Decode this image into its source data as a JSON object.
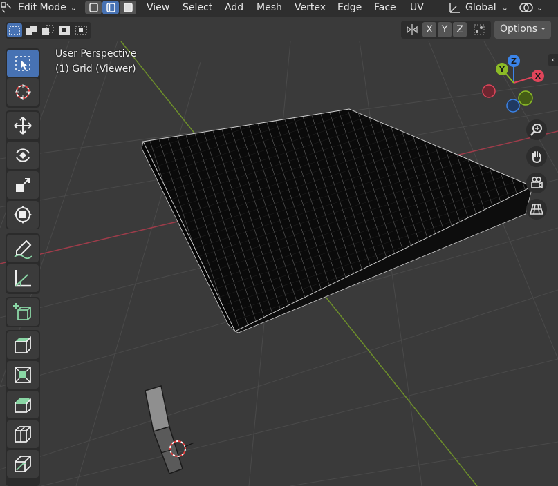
{
  "header": {
    "mode_label": "Edit Mode",
    "menus": [
      "View",
      "Select",
      "Add",
      "Mesh",
      "Vertex",
      "Edge",
      "Face",
      "UV"
    ],
    "transform_orientation": "Global"
  },
  "subheader": {
    "axis_buttons": [
      "X",
      "Y",
      "Z"
    ],
    "options_label": "Options"
  },
  "viewport": {
    "perspective_label": "User Perspective",
    "object_label": "(1) Grid (Viewer)"
  },
  "gizmo": {
    "x_label": "X",
    "y_label": "Y",
    "z_label": "Z"
  },
  "colors": {
    "accent": "#4772b3",
    "x_axis": "#e0455a",
    "y_axis": "#8bbb26",
    "z_axis": "#3b84e8",
    "background": "#3a3a3a"
  },
  "toolbar": {
    "tools": [
      "select-box-icon",
      "cursor-icon",
      "move-icon",
      "rotate-icon",
      "scale-icon",
      "transform-icon",
      "annotate-icon",
      "measure-icon",
      "add-cube-icon",
      "extrude-icon",
      "inset-icon",
      "bevel-icon",
      "loop-cut-icon",
      "knife-icon"
    ]
  }
}
